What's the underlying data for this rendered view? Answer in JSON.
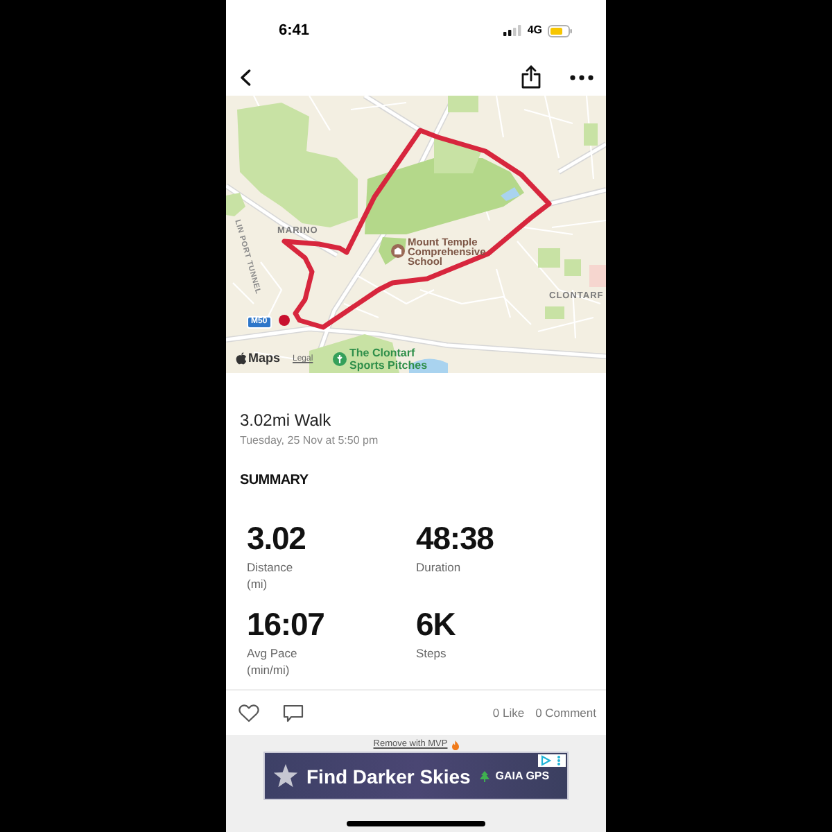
{
  "status_bar": {
    "time": "6:41",
    "network": "4G"
  },
  "map": {
    "neighbourhoods": [
      "MARINO",
      "CLONTARF"
    ],
    "school": "Mount Temple Comprehensive School",
    "sports_ground": "The Clontarf Sports Pitches",
    "road_shield": "M50",
    "tunnel_road": "LIN PORT TUNNEL",
    "attribution": "Maps",
    "legal_link": "Legal"
  },
  "activity": {
    "title": "3.02mi Walk",
    "date": "Tuesday, 25 Nov at 5:50 pm"
  },
  "summary": {
    "heading": "SUMMARY",
    "stats": [
      {
        "value": "3.02",
        "label": "Distance",
        "unit": "(mi)"
      },
      {
        "value": "48:38",
        "label": "Duration"
      },
      {
        "value": "16:07",
        "label": "Avg Pace",
        "unit": "(min/mi)"
      },
      {
        "value": "6K",
        "label": "Steps"
      }
    ]
  },
  "social": {
    "likes": "0 Like",
    "comments": "0 Comment"
  },
  "ad": {
    "remove_link": "Remove with MVP",
    "headline": "Find Darker Skies",
    "brand": "GAIA GPS"
  }
}
